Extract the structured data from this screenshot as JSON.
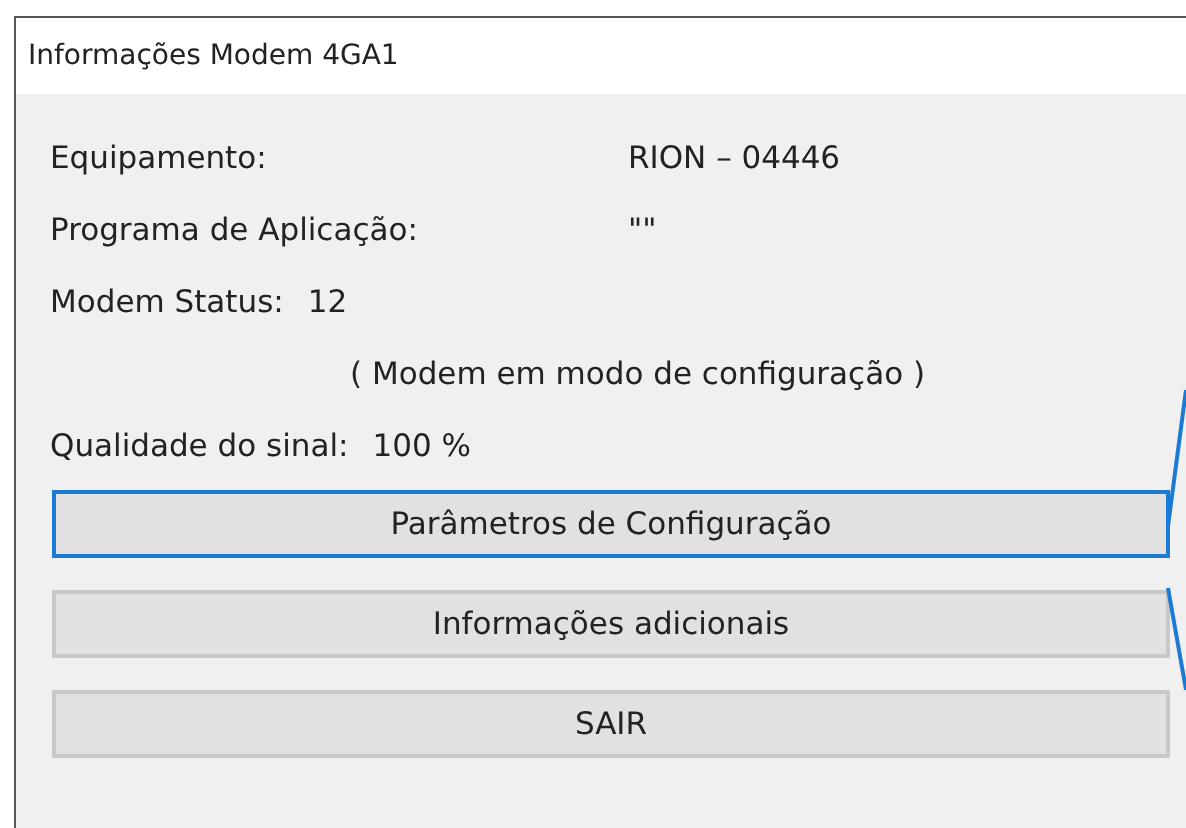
{
  "window": {
    "title": "Informações Modem 4GA1"
  },
  "info_rows": [
    {
      "kind": "column",
      "label": "Equipamento:",
      "value": "RION – 04446"
    },
    {
      "kind": "column",
      "label": "Programa de Aplicação:",
      "value": "\"\""
    },
    {
      "kind": "inline",
      "label": "Modem Status:",
      "value": "12"
    },
    {
      "kind": "note",
      "value": "( Modem em modo de configuração )"
    },
    {
      "kind": "inline",
      "label": "Qualidade do sinal:",
      "value": "100 %"
    }
  ],
  "buttons": [
    {
      "label": "Parâmetros de Configuração",
      "focused": true
    },
    {
      "label": "Informações adicionais",
      "focused": false
    },
    {
      "label": "SAIR",
      "focused": false
    }
  ],
  "callout": {
    "visible": true
  }
}
